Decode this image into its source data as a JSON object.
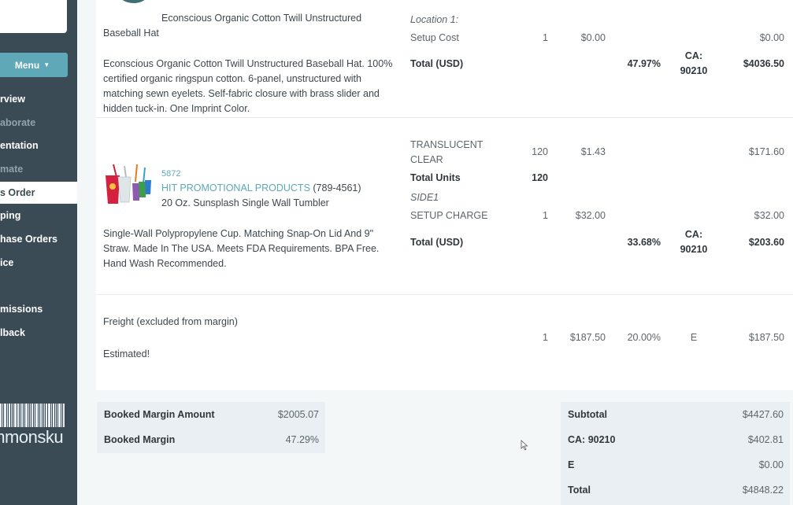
{
  "sidebar": {
    "menu_label": "Menu",
    "items": [
      {
        "label": "rview",
        "state": "normal"
      },
      {
        "label": "aborate",
        "state": "dim"
      },
      {
        "label": "entation",
        "state": "normal"
      },
      {
        "label": "mate",
        "state": "dim"
      },
      {
        "label": "s Order",
        "state": "active"
      },
      {
        "label": "ping",
        "state": "normal"
      },
      {
        "label": "hase Orders",
        "state": "normal"
      },
      {
        "label": "ice",
        "state": "normal"
      },
      {
        "label": "missions",
        "state": "normal"
      },
      {
        "label": "lback",
        "state": "normal"
      }
    ],
    "logo_text": "commonsku"
  },
  "items": [
    {
      "title_line1": "Econscious Organic Cotton Twill Unstructured",
      "title_line2": "Baseball Hat",
      "description": "Econscious Organic Cotton Twill Unstructured Baseball Hat. 100% certified organic ringspun cotton. 6-panel, unstructured with matching sewn eyelets. Self-fabric closure with brass slider and hidden tuck-in. One Imprint Color.",
      "location": "Location 1:",
      "setup_label": "Setup Cost",
      "setup_qty": "1",
      "setup_price": "$0.00",
      "setup_total": "$0.00",
      "total_label": "Total (USD)",
      "margin": "47.97%",
      "tax_line1": "CA:",
      "tax_line2": "90210",
      "total_amount": "$4036.50"
    },
    {
      "sku": "5872",
      "supplier": "HIT PROMOTIONAL PRODUCTS",
      "phone": "(789-4561)",
      "name": "20 Oz. Sunsplash Single Wall Tumbler",
      "description": "Single-Wall Polypropylene Cup. Matching Snap-On Lid And 9\" Straw. Made In The USA. Meets FDA Requirements. BPA Free. Hand Wash Recommended.",
      "variant_line1": "TRANSLUCENT",
      "variant_line2": "CLEAR",
      "variant_qty": "120",
      "variant_price": "$1.43",
      "variant_total": "$171.60",
      "units_label": "Total Units",
      "units_value": "120",
      "side_label": "SIDE1",
      "setup_label": "SETUP CHARGE",
      "setup_qty": "1",
      "setup_price": "$32.00",
      "setup_total": "$32.00",
      "total_label": "Total (USD)",
      "margin": "33.68%",
      "tax_line1": "CA:",
      "tax_line2": "90210",
      "total_amount": "$203.60"
    }
  ],
  "freight": {
    "label": "Freight (excluded from margin)",
    "note": "Estimated!",
    "qty": "1",
    "price": "$187.50",
    "margin": "20.00%",
    "tax": "E",
    "total": "$187.50"
  },
  "margin_summary": {
    "amount_label": "Booked Margin Amount",
    "amount_value": "$2005.07",
    "margin_label": "Booked Margin",
    "margin_value": "47.29%"
  },
  "totals": {
    "subtotal_label": "Subtotal",
    "subtotal_value": "$4427.60",
    "tax1_label": "CA: 90210",
    "tax1_value": "$402.81",
    "tax2_label": "E",
    "tax2_value": "$0.00",
    "total_label": "Total",
    "total_value": "$4848.22"
  },
  "colors": {
    "sidebar_bg": "#3a4b55",
    "accent_teal": "#5ea8b8",
    "accent_pink": "#d5436a",
    "summary_bg": "#e9eff2"
  }
}
